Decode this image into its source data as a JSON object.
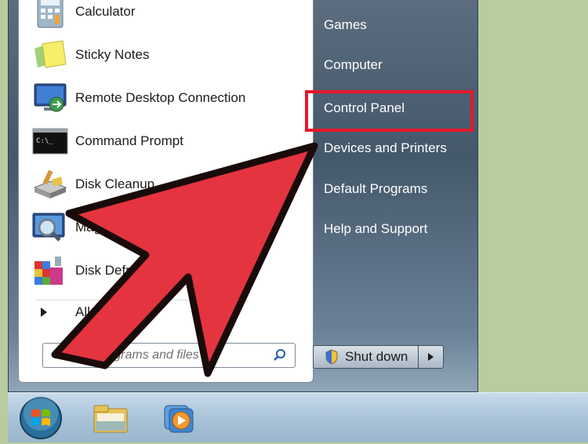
{
  "programs": [
    {
      "label": "Calculator",
      "icon": "calculator-icon"
    },
    {
      "label": "Sticky Notes",
      "icon": "sticky-notes-icon"
    },
    {
      "label": "Remote Desktop Connection",
      "icon": "remote-desktop-icon"
    },
    {
      "label": "Command Prompt",
      "icon": "command-prompt-icon"
    },
    {
      "label": "Disk Cleanup",
      "icon": "disk-cleanup-icon"
    },
    {
      "label": "Magnifier",
      "icon": "magnifier-icon"
    },
    {
      "label": "Disk Defragmenter",
      "icon": "disk-defragmenter-icon"
    }
  ],
  "all_programs_label": "All Programs",
  "search": {
    "placeholder": "Search programs and files"
  },
  "right_pane": {
    "items": [
      "Games",
      "Computer",
      "Control Panel",
      "Devices and Printers",
      "Default Programs",
      "Help and Support"
    ],
    "highlighted": "Control Panel"
  },
  "shutdown": {
    "label": "Shut down"
  },
  "colors": {
    "highlight": "#e5182a",
    "arrow": "#e3343f",
    "background": "#b9cca0"
  },
  "taskbar": {
    "items": [
      "start-orb-icon",
      "windows-explorer-icon",
      "media-player-icon"
    ]
  }
}
